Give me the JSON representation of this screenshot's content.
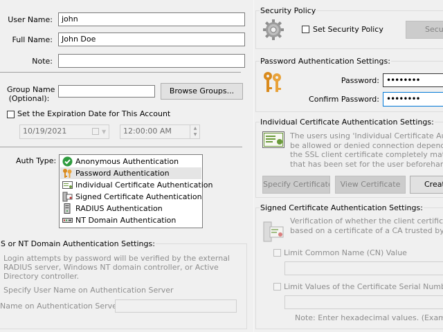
{
  "user": {
    "user_name_label": "User Name:",
    "user_name_value": "john",
    "full_name_label": "Full Name:",
    "full_name_value": "John Doe",
    "note_label": "Note:",
    "note_value": ""
  },
  "group": {
    "label_line1": "Group Name",
    "label_line2": "(Optional):",
    "value": "",
    "browse_button": "Browse Groups..."
  },
  "expiration": {
    "checkbox_label": "Set the Expiration Date for This Account",
    "date_value": "10/19/2021",
    "time_value": "12:00:00 AM"
  },
  "auth": {
    "label": "Auth Type:",
    "items": [
      {
        "label": "Anonymous Authentication",
        "icon": "anonymous-check-icon"
      },
      {
        "label": "Password Authentication",
        "icon": "keys-icon"
      },
      {
        "label": "Individual Certificate Authentication",
        "icon": "certificate-icon"
      },
      {
        "label": "Signed Certificate Authentication",
        "icon": "signed-certificate-icon"
      },
      {
        "label": "RADIUS Authentication",
        "icon": "radius-server-icon"
      },
      {
        "label": "NT Domain Authentication",
        "icon": "nt-domain-icon"
      }
    ],
    "selected_index": 1
  },
  "radius": {
    "title": "S or NT Domain Authentication Settings:",
    "description": "Login attempts by password will be verified by the external RADIUS server, Windows NT domain controller, or Active Directory controller.",
    "specify_label": "Specify User Name on Authentication Server",
    "server_name_label": "Name on Authentication Server:",
    "server_name_value": ""
  },
  "security": {
    "title": "Security Policy",
    "checkbox_label": "Set Security Policy",
    "button": "Secu"
  },
  "password": {
    "title": "Password Authentication Settings:",
    "password_label": "Password:",
    "password_value": "••••••••",
    "confirm_label": "Confirm Password:",
    "confirm_value": "••••••••"
  },
  "individual_cert": {
    "title": "Individual Certificate Authentication Settings:",
    "desc_lines": [
      "The users using 'Individual Certificate Auth",
      "be allowed or denied connection dependin",
      "the SSL client certificate completely matche",
      "that has been set for the user beforehand."
    ],
    "specify_button": "Specify Certificate",
    "view_button": "View Certificate",
    "create_button": "Creat"
  },
  "signed_cert": {
    "title": "Signed Certificate Authentication Settings:",
    "desc_lines": [
      "Verification of whether the client certific",
      "based on a certificate of a CA trusted by th"
    ],
    "limit_cn_label": "Limit Common Name (CN) Value",
    "limit_serial_label": "Limit Values of the Certificate Serial Number",
    "note": "Note: Enter hexadecimal values. (Example:"
  },
  "colors": {
    "background": "#f0f0f0",
    "check_green": "#2e9b3e",
    "key_orange": "#d98a1c"
  }
}
